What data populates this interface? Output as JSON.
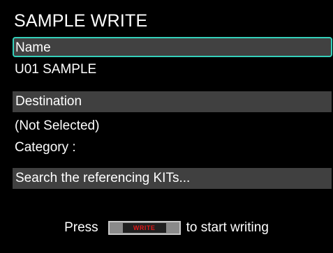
{
  "screen": {
    "title": "SAMPLE WRITE"
  },
  "fields": {
    "name_label": "Name",
    "name_value": "U01 SAMPLE",
    "destination_label": "Destination",
    "destination_value": "(Not Selected)",
    "category_label": "Category :",
    "search_label": "Search the referencing KITs..."
  },
  "footer": {
    "prefix": "Press",
    "button_label": "WRITE",
    "suffix": "to start writing"
  },
  "colors": {
    "background": "#000000",
    "bar": "#404040",
    "focus_border": "#34d0ba",
    "write_text": "#e01818"
  }
}
